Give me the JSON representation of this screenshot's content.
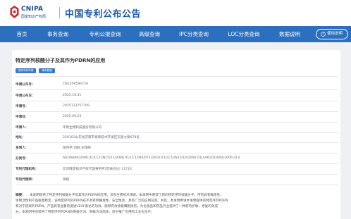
{
  "header": {
    "logo_en": "CNIPA",
    "logo_cn": "国家知识产权局",
    "site_title": "中国专利公布公告"
  },
  "nav": {
    "items": [
      "首页",
      "事务查询",
      "专利公报查询",
      "高级查询",
      "IPC分类查询",
      "LOC分类查询",
      "数据说明"
    ],
    "help": "使用说明"
  },
  "document": {
    "title": "特定序列核酸分子及其作为PDRN的应用",
    "buttons": [
      "发明专利申请",
      "事务数据"
    ],
    "fields": [
      {
        "label": "申请公布号：",
        "value": "CN120859673A"
      },
      {
        "label": "申请公布日：",
        "value": "2025.10.31"
      },
      {
        "label": "申请号：",
        "value": "2025113757709"
      },
      {
        "label": "申请日：",
        "value": "2025.09.23"
      },
      {
        "label": "申请人：",
        "value": "华熙生物科技股份有限公司"
      },
      {
        "label": "地址：",
        "value": "250101山东省济南市高新技术开发区天辰大街678号"
      },
      {
        "label": "发明人：",
        "value": "张伟平;刘丽;王瑞婷"
      },
      {
        "label": "分类号：",
        "value": "A61K8/60(2006.01)I;C12N15/11(2006.01)I;C12N5/071(2010.01)I;C12N15/10(2006.01)I;A61Q19/00(2006.01)I"
      },
      {
        "label": "专利代理机构：",
        "value": "北京隆亚知识产权代理事务所(普通合伙) 11716"
      },
      {
        "label": "专利代理师：",
        "value": "蒋楠"
      }
    ],
    "abstract_label": "摘要：",
    "abstract_lines": [
      "本发明提供了特定序列核酸分子及其作为PDRN的应用，涉及生物技术领域。本发明中获得了新的特定序列核酸分子，序列具有确定性、",
      "生物活性和产品质量稳定，该特定序列的PDRN在不具有明确毒性、安全性高、具有广泛的应用前景。并且，本发明申请本发明提供的特定序列PDRN",
      "和对于提取的PDRN，产品具有显著的促进VEGF表达的功效，能够有效修复细胞损伤，为化妆品和药品行业提供了一种新的护肤、修复的效成",
      "分，本发明中还提供了特定序列PDRN的制备方法、制备方法简单，适于推广应用和工业化生产。"
    ]
  }
}
